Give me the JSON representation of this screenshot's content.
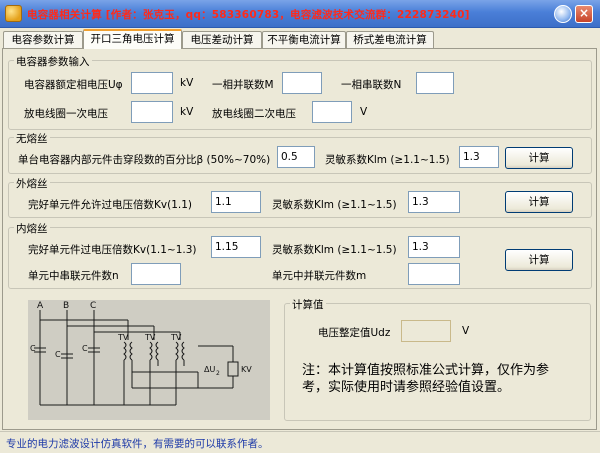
{
  "window": {
    "title": "电容器相关计算 [作者：张克玉，qq：583360783，电容滤波技术交流群：222873240]",
    "close_glyph": "×"
  },
  "tabs": [
    {
      "label": "电容参数计算"
    },
    {
      "label": "开口三角电压计算",
      "active": true
    },
    {
      "label": "电压差动计算"
    },
    {
      "label": "不平衡电流计算"
    },
    {
      "label": "桥式差电流计算"
    }
  ],
  "params": {
    "legend": "电容器参数输入",
    "rated_voltage_label": "电容器额定相电压Uφ",
    "rated_voltage_unit": "kV",
    "parallel_label": "一相并联数M",
    "series_label": "一相串联数N",
    "primary_label": "放电线圈一次电压",
    "primary_unit": "kV",
    "secondary_label": "放电线圈二次电压",
    "secondary_unit": "V"
  },
  "nofuse": {
    "legend": "无熔丝",
    "breakdown_label": "单台电容器内部元件击穿段数的百分比β (50%~70%)",
    "breakdown_value": "0.5",
    "sensitivity_label": "灵敏系数Klm (≥1.1~1.5)",
    "sensitivity_value": "1.3",
    "calc_label": "计算"
  },
  "extfuse": {
    "legend": "外熔丝",
    "overvolt_label": "完好单元件允许过电压倍数Kv(1.1)",
    "overvolt_value": "1.1",
    "sensitivity_label": "灵敏系数Klm (≥1.1~1.5)",
    "sensitivity_value": "1.3",
    "calc_label": "计算"
  },
  "intfuse": {
    "legend": "内熔丝",
    "overvolt_label": "完好单元件过电压倍数Kv(1.1~1.3)",
    "overvolt_value": "1.15",
    "sensitivity_label": "灵敏系数Klm (≥1.1~1.5)",
    "sensitivity_value": "1.3",
    "series_elem_label": "单元中串联元件数n",
    "parallel_elem_label": "单元中并联元件数m",
    "calc_label": "计算"
  },
  "circuit": {
    "phase_a": "A",
    "phase_b": "B",
    "phase_c": "C",
    "cap": "C",
    "tv": "TV",
    "delta_u": "ΔU",
    "delta_u_sub": "2",
    "kv": "KV"
  },
  "result": {
    "legend": "计算值",
    "setting_label": "电压整定值Udz",
    "setting_unit": "V"
  },
  "note": "注：本计算值按照标准公式计算，仅作为参考，实际使用时请参照经验值设置。",
  "status": "专业的电力滤波设计仿真软件，有需要的可以联系作者。"
}
